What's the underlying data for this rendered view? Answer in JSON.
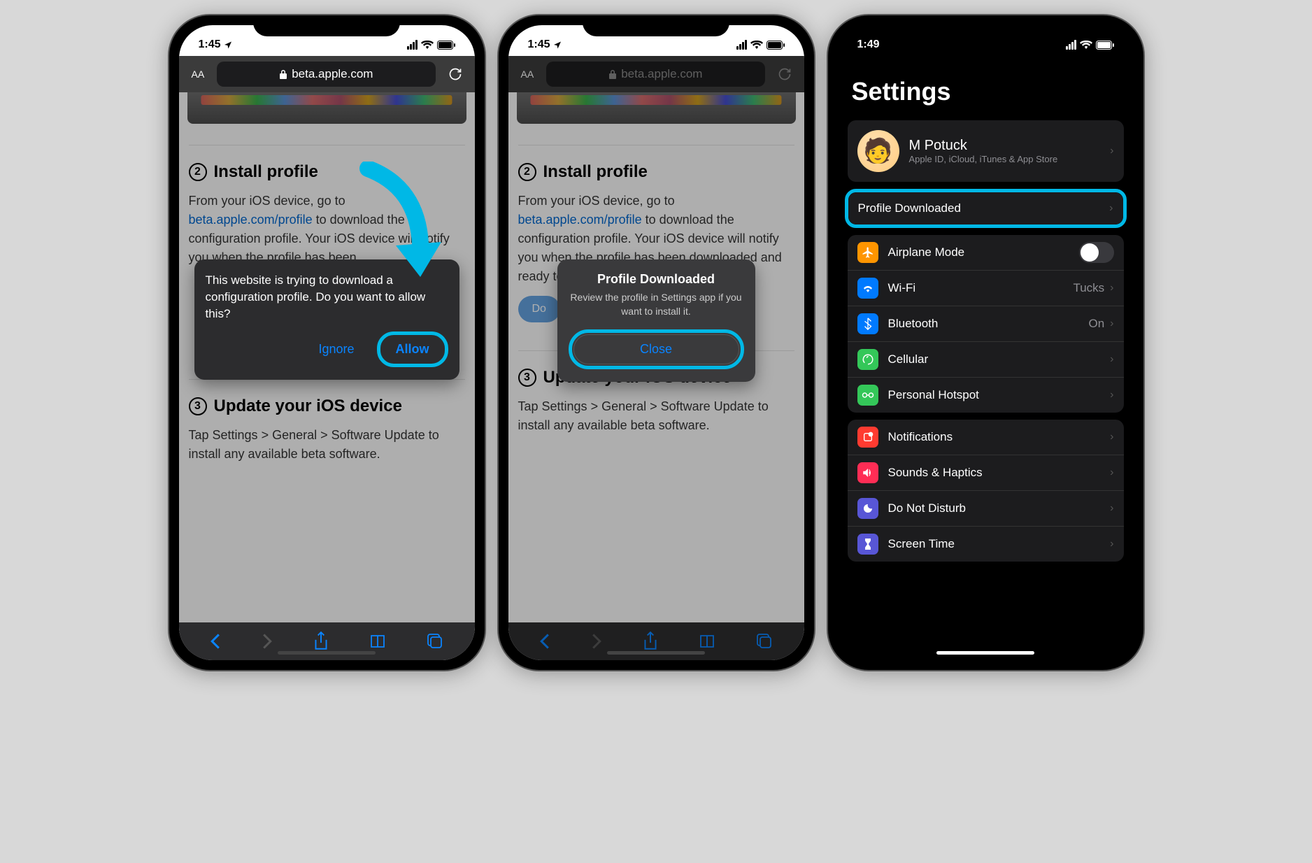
{
  "screen1": {
    "time": "1:45",
    "url": "beta.apple.com",
    "section2_title": "Install profile",
    "section2_text_start": "From your iOS device, go to ",
    "section2_link": "beta.apple.com/profile",
    "section2_text_end": " to download the configuration profile. Your iOS device will notify you when the profile has been",
    "popup_text": "This website is trying to download a configuration profile. Do you want to allow this?",
    "popup_ignore": "Ignore",
    "popup_allow": "Allow",
    "section3_title": "Update your iOS device",
    "section3_text": "Tap Settings > General > Software Update to install any available beta software."
  },
  "screen2": {
    "time": "1:45",
    "url": "beta.apple.com",
    "section2_title": "Install profile",
    "section2_text_start": "From your iOS device, go to ",
    "section2_link": "beta.apple.com/profile",
    "section2_text_end": " to download the configuration profile. Your iOS device will notify you when the profile has been downloaded and ready to install.",
    "download_btn": "Download profile",
    "popup_title": "Profile Downloaded",
    "popup_sub": "Review the profile in Settings app if you want to install it.",
    "popup_close": "Close",
    "section3_title": "Update your iOS device",
    "section3_text": "Tap Settings > General > Software Update to install any available beta software."
  },
  "screen3": {
    "time": "1:49",
    "title": "Settings",
    "profile_name": "M Potuck",
    "profile_sub": "Apple ID, iCloud, iTunes & App Store",
    "profile_downloaded": "Profile Downloaded",
    "rows1": [
      {
        "label": "Airplane Mode",
        "icon_color": "#ff9500",
        "has_toggle": true
      },
      {
        "label": "Wi-Fi",
        "icon_color": "#007aff",
        "value": "Tucks"
      },
      {
        "label": "Bluetooth",
        "icon_color": "#007aff",
        "value": "On"
      },
      {
        "label": "Cellular",
        "icon_color": "#34c759"
      },
      {
        "label": "Personal Hotspot",
        "icon_color": "#34c759"
      }
    ],
    "rows2": [
      {
        "label": "Notifications",
        "icon_color": "#ff3b30"
      },
      {
        "label": "Sounds & Haptics",
        "icon_color": "#ff2d55"
      },
      {
        "label": "Do Not Disturb",
        "icon_color": "#5856d6"
      },
      {
        "label": "Screen Time",
        "icon_color": "#5856d6"
      }
    ]
  }
}
